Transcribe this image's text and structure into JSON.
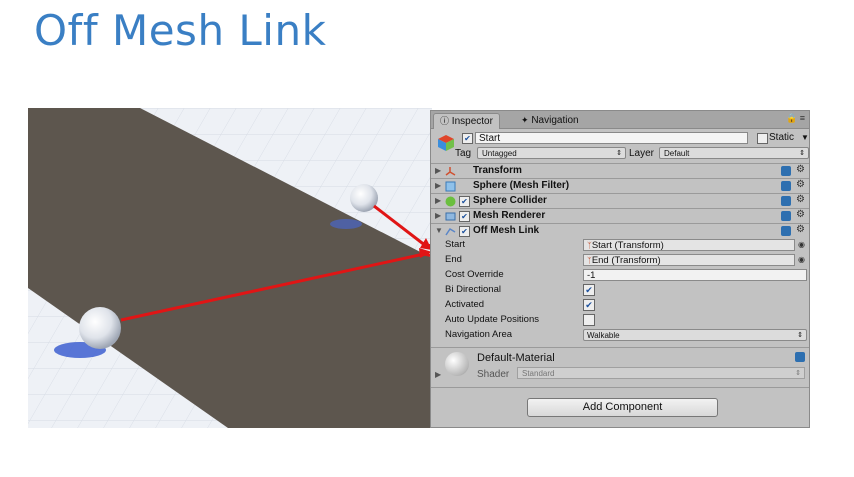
{
  "slide": {
    "title": "Off Mesh Link"
  },
  "inspector": {
    "tabs": [
      {
        "label": "Inspector",
        "icon": "info-icon"
      },
      {
        "label": "Navigation",
        "icon": "navigation-icon"
      }
    ],
    "game_object": {
      "name": "Start",
      "active": true,
      "static_label": "Static",
      "tag_label": "Tag",
      "tag_value": "Untagged",
      "layer_label": "Layer",
      "layer_value": "Default"
    },
    "components": [
      {
        "title": "Transform",
        "icon": "transform-icon"
      },
      {
        "title": "Sphere (Mesh Filter)",
        "icon": "mesh-filter-icon"
      },
      {
        "title": "Sphere Collider",
        "icon": "sphere-collider-icon",
        "enabled": true
      },
      {
        "title": "Mesh Renderer",
        "icon": "mesh-renderer-icon",
        "enabled": true
      },
      {
        "title": "Off Mesh Link",
        "icon": "off-mesh-link-icon",
        "enabled": true,
        "expanded": true
      }
    ],
    "off_mesh_link": {
      "start_label": "Start",
      "start_value": "Start (Transform)",
      "end_label": "End",
      "end_value": "End (Transform)",
      "cost_label": "Cost Override",
      "cost_value": "-1",
      "bidir_label": "Bi Directional",
      "bidir_checked": true,
      "activated_label": "Activated",
      "activated_checked": true,
      "auto_update_label": "Auto Update Positions",
      "auto_update_checked": false,
      "nav_area_label": "Navigation Area",
      "nav_area_value": "Walkable"
    },
    "material": {
      "name": "Default-Material",
      "shader_label": "Shader",
      "shader_value": "Standard"
    },
    "add_component_label": "Add Component"
  },
  "colors": {
    "title_blue": "#3a7fc4",
    "arrow_red": "#e01515",
    "panel_gray": "#c2c2c2",
    "floor_brown": "#5d564e"
  }
}
